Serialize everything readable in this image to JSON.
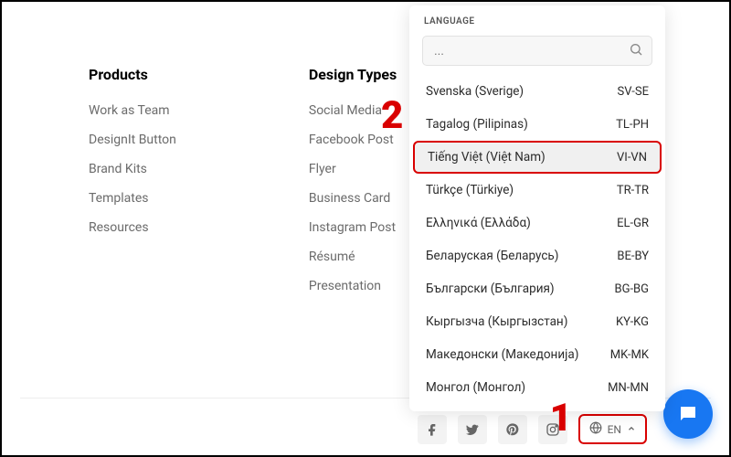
{
  "columns": {
    "products": {
      "heading": "Products",
      "items": [
        "Work as Team",
        "DesignIt Button",
        "Brand Kits",
        "Templates",
        "Resources"
      ]
    },
    "designTypes": {
      "heading": "Design Types",
      "items": [
        "Social Media",
        "Facebook Post",
        "Flyer",
        "Business Card",
        "Instagram Post",
        "Résumé",
        "Presentation"
      ]
    }
  },
  "language": {
    "header": "LANGUAGE",
    "searchPlaceholder": "...",
    "options": [
      {
        "name": "Svenska (Sverige)",
        "code": "SV-SE"
      },
      {
        "name": "Tagalog (Pilipinas)",
        "code": "TL-PH"
      },
      {
        "name": "Tiếng Việt (Việt Nam)",
        "code": "VI-VN"
      },
      {
        "name": "Türkçe (Türkiye)",
        "code": "TR-TR"
      },
      {
        "name": "Ελληνικά (Ελλάδα)",
        "code": "EL-GR"
      },
      {
        "name": "Беларуская (Беларусь)",
        "code": "BE-BY"
      },
      {
        "name": "Български (България)",
        "code": "BG-BG"
      },
      {
        "name": "Кыргызча (Кыргызстан)",
        "code": "KY-KG"
      },
      {
        "name": "Македонски (Македонија)",
        "code": "MK-MK"
      },
      {
        "name": "Монгол (Монгол)",
        "code": "MN-MN"
      }
    ],
    "highlightedIndex": 2,
    "currentShort": "EN"
  },
  "callouts": {
    "one": "1",
    "two": "2"
  }
}
